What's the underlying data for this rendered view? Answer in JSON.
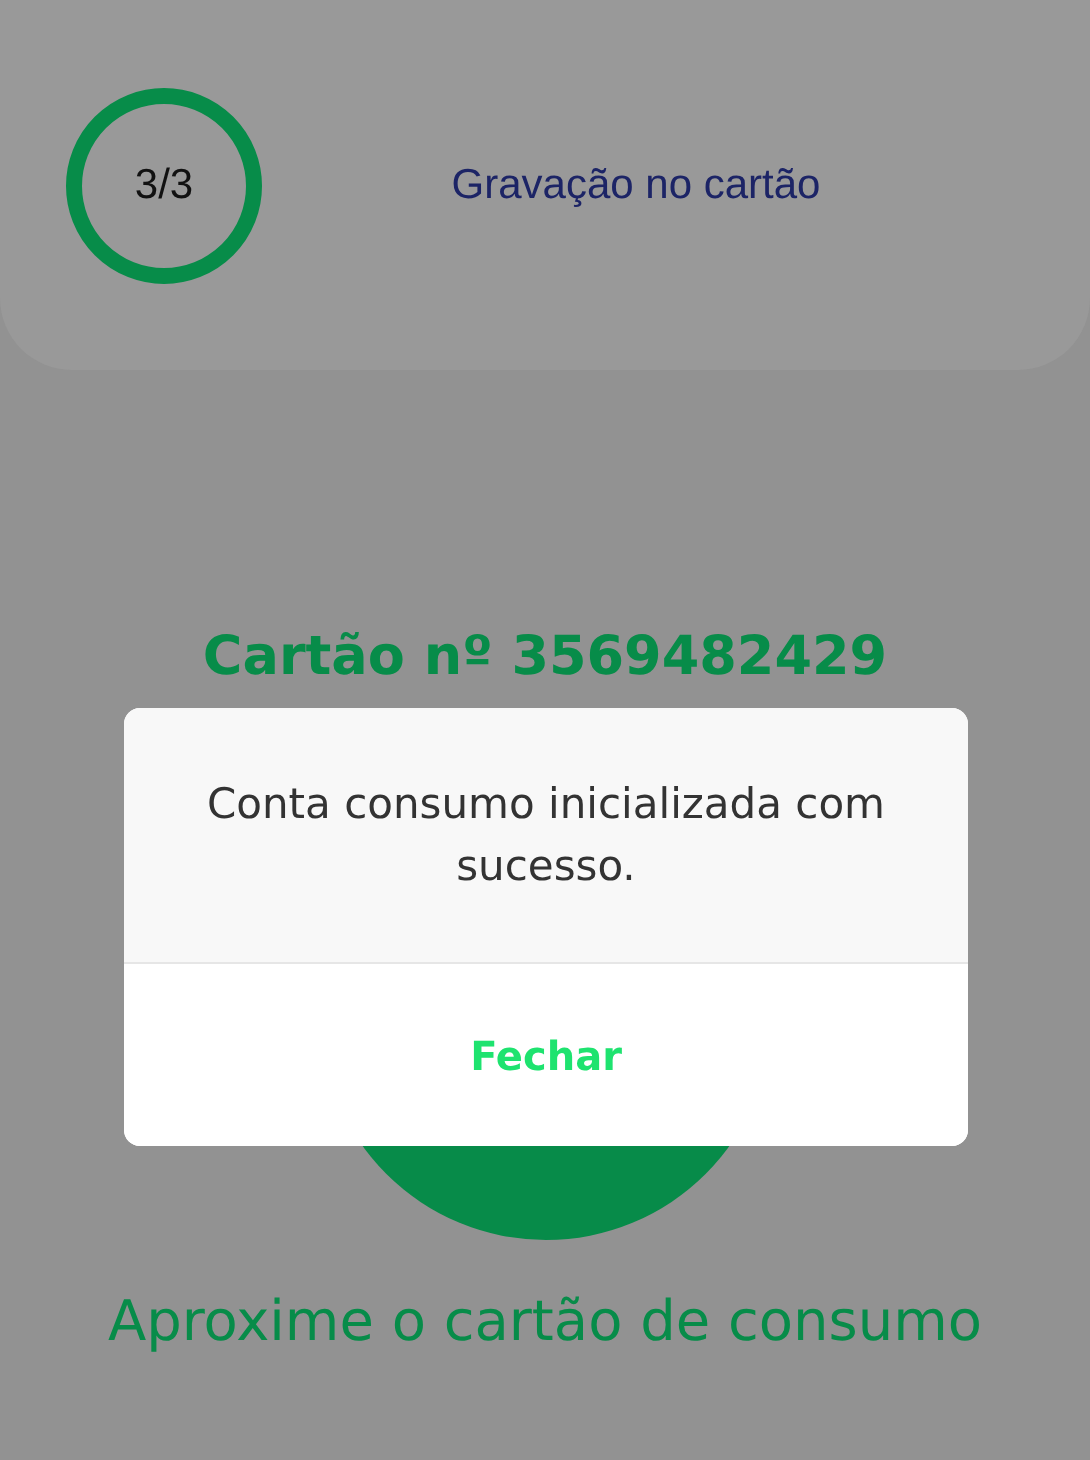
{
  "header": {
    "step": "3/3",
    "title": "Gravação no cartão"
  },
  "card_number": "Cartão nº 3569482429",
  "dialog": {
    "message": "Conta consumo inicializada com sucesso.",
    "button": "Fechar"
  },
  "instruction": "Aproxime o cartão de consumo"
}
